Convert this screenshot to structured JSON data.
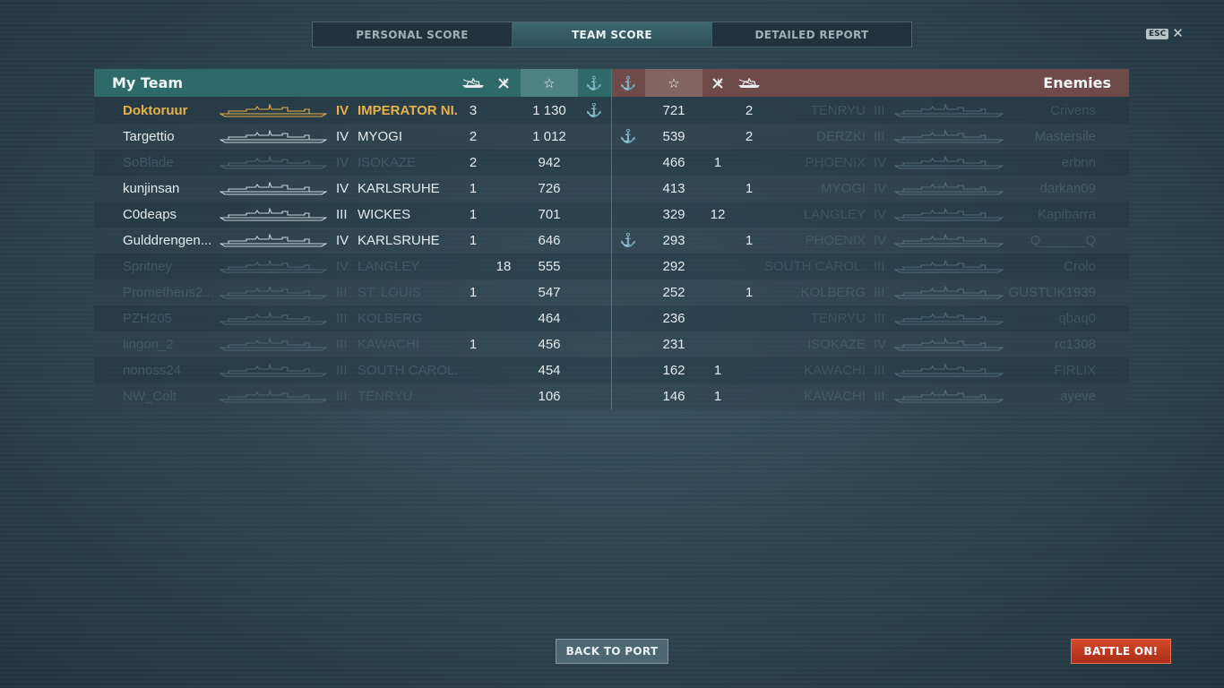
{
  "tabs": [
    {
      "label": "PERSONAL SCORE",
      "active": false
    },
    {
      "label": "TEAM SCORE",
      "active": true
    },
    {
      "label": "DETAILED REPORT",
      "active": false
    }
  ],
  "esc_label": "ESC",
  "close_glyph": "✕",
  "my_team": {
    "title": "My Team",
    "header_icons": [
      "ships-destroyed-icon",
      "planes-destroyed-icon",
      "star-icon",
      "anchor-icon"
    ],
    "rows": [
      {
        "player": "Doktoruur",
        "tier": "IV",
        "ship": "IMPERATOR NI...",
        "kills": "3",
        "planes": "",
        "score": "1 130",
        "anchor": true,
        "status": "me"
      },
      {
        "player": "Targettio",
        "tier": "IV",
        "ship": "MYOGI",
        "kills": "2",
        "planes": "",
        "score": "1 012",
        "anchor": false,
        "status": "alive"
      },
      {
        "player": "SoBlade",
        "tier": "IV",
        "ship": "ISOKAZE",
        "kills": "2",
        "planes": "",
        "score": "942",
        "anchor": false,
        "status": "dead"
      },
      {
        "player": "kunjinsan",
        "tier": "IV",
        "ship": "KARLSRUHE",
        "kills": "1",
        "planes": "",
        "score": "726",
        "anchor": false,
        "status": "alive"
      },
      {
        "player": "C0deaps",
        "tier": "III",
        "ship": "WICKES",
        "kills": "1",
        "planes": "",
        "score": "701",
        "anchor": false,
        "status": "alive"
      },
      {
        "player": "Gulddrengen...",
        "tier": "IV",
        "ship": "KARLSRUHE",
        "kills": "1",
        "planes": "",
        "score": "646",
        "anchor": false,
        "status": "alive"
      },
      {
        "player": "Spritney",
        "tier": "IV",
        "ship": "LANGLEY",
        "kills": "",
        "planes": "18",
        "score": "555",
        "anchor": false,
        "status": "dead"
      },
      {
        "player": "Prometheus2...",
        "tier": "III",
        "ship": "ST. LOUIS",
        "kills": "1",
        "planes": "",
        "score": "547",
        "anchor": false,
        "status": "dead"
      },
      {
        "player": "PZH205",
        "tier": "III",
        "ship": "KOLBERG",
        "kills": "",
        "planes": "",
        "score": "464",
        "anchor": false,
        "status": "dead"
      },
      {
        "player": "lingon_2",
        "tier": "III",
        "ship": "KAWACHI",
        "kills": "1",
        "planes": "",
        "score": "456",
        "anchor": false,
        "status": "dead"
      },
      {
        "player": "nonoss24",
        "tier": "III",
        "ship": "SOUTH CAROL...",
        "kills": "",
        "planes": "",
        "score": "454",
        "anchor": false,
        "status": "dead"
      },
      {
        "player": "NW_Colt",
        "tier": "III",
        "ship": "TENRYU",
        "kills": "",
        "planes": "",
        "score": "106",
        "anchor": false,
        "status": "dead"
      }
    ]
  },
  "enemies": {
    "title": "Enemies",
    "header_icons": [
      "anchor-icon",
      "star-icon",
      "planes-destroyed-icon",
      "ships-destroyed-icon"
    ],
    "rows": [
      {
        "player": "Crivens",
        "tier": "III",
        "ship": "TENRYU",
        "kills": "2",
        "planes": "",
        "score": "721",
        "anchor": false
      },
      {
        "player": "Mastersile",
        "tier": "III",
        "ship": "DERZKI",
        "kills": "2",
        "planes": "",
        "score": "539",
        "anchor": true
      },
      {
        "player": "erbnn",
        "tier": "IV",
        "ship": "PHOENIX",
        "kills": "",
        "planes": "1",
        "score": "466",
        "anchor": false
      },
      {
        "player": "darkan09",
        "tier": "IV",
        "ship": "MYOGI",
        "kills": "1",
        "planes": "",
        "score": "413",
        "anchor": false
      },
      {
        "player": "Kapibarra",
        "tier": "IV",
        "ship": "LANGLEY",
        "kills": "",
        "planes": "12",
        "score": "329",
        "anchor": false
      },
      {
        "player": "Q______Q",
        "tier": "IV",
        "ship": "PHOENIX",
        "kills": "1",
        "planes": "",
        "score": "293",
        "anchor": true
      },
      {
        "player": "Crolo",
        "tier": "III",
        "ship": "SOUTH CAROL...",
        "kills": "",
        "planes": "",
        "score": "292",
        "anchor": false
      },
      {
        "player": "GUSTLIK1939",
        "tier": "III",
        "ship": "KOLBERG",
        "kills": "1",
        "planes": "",
        "score": "252",
        "anchor": false
      },
      {
        "player": "qbaq0",
        "tier": "III",
        "ship": "TENRYU",
        "kills": "",
        "planes": "",
        "score": "236",
        "anchor": false
      },
      {
        "player": "rc1308",
        "tier": "IV",
        "ship": "ISOKAZE",
        "kills": "",
        "planes": "",
        "score": "231",
        "anchor": false
      },
      {
        "player": "FIRLIX",
        "tier": "III",
        "ship": "KAWACHI",
        "kills": "",
        "planes": "1",
        "score": "162",
        "anchor": false
      },
      {
        "player": "ayeve",
        "tier": "III",
        "ship": "KAWACHI",
        "kills": "",
        "planes": "1",
        "score": "146",
        "anchor": false
      }
    ]
  },
  "buttons": {
    "back_to_port": "BACK TO PORT",
    "battle_on": "BATTLE ON!"
  }
}
